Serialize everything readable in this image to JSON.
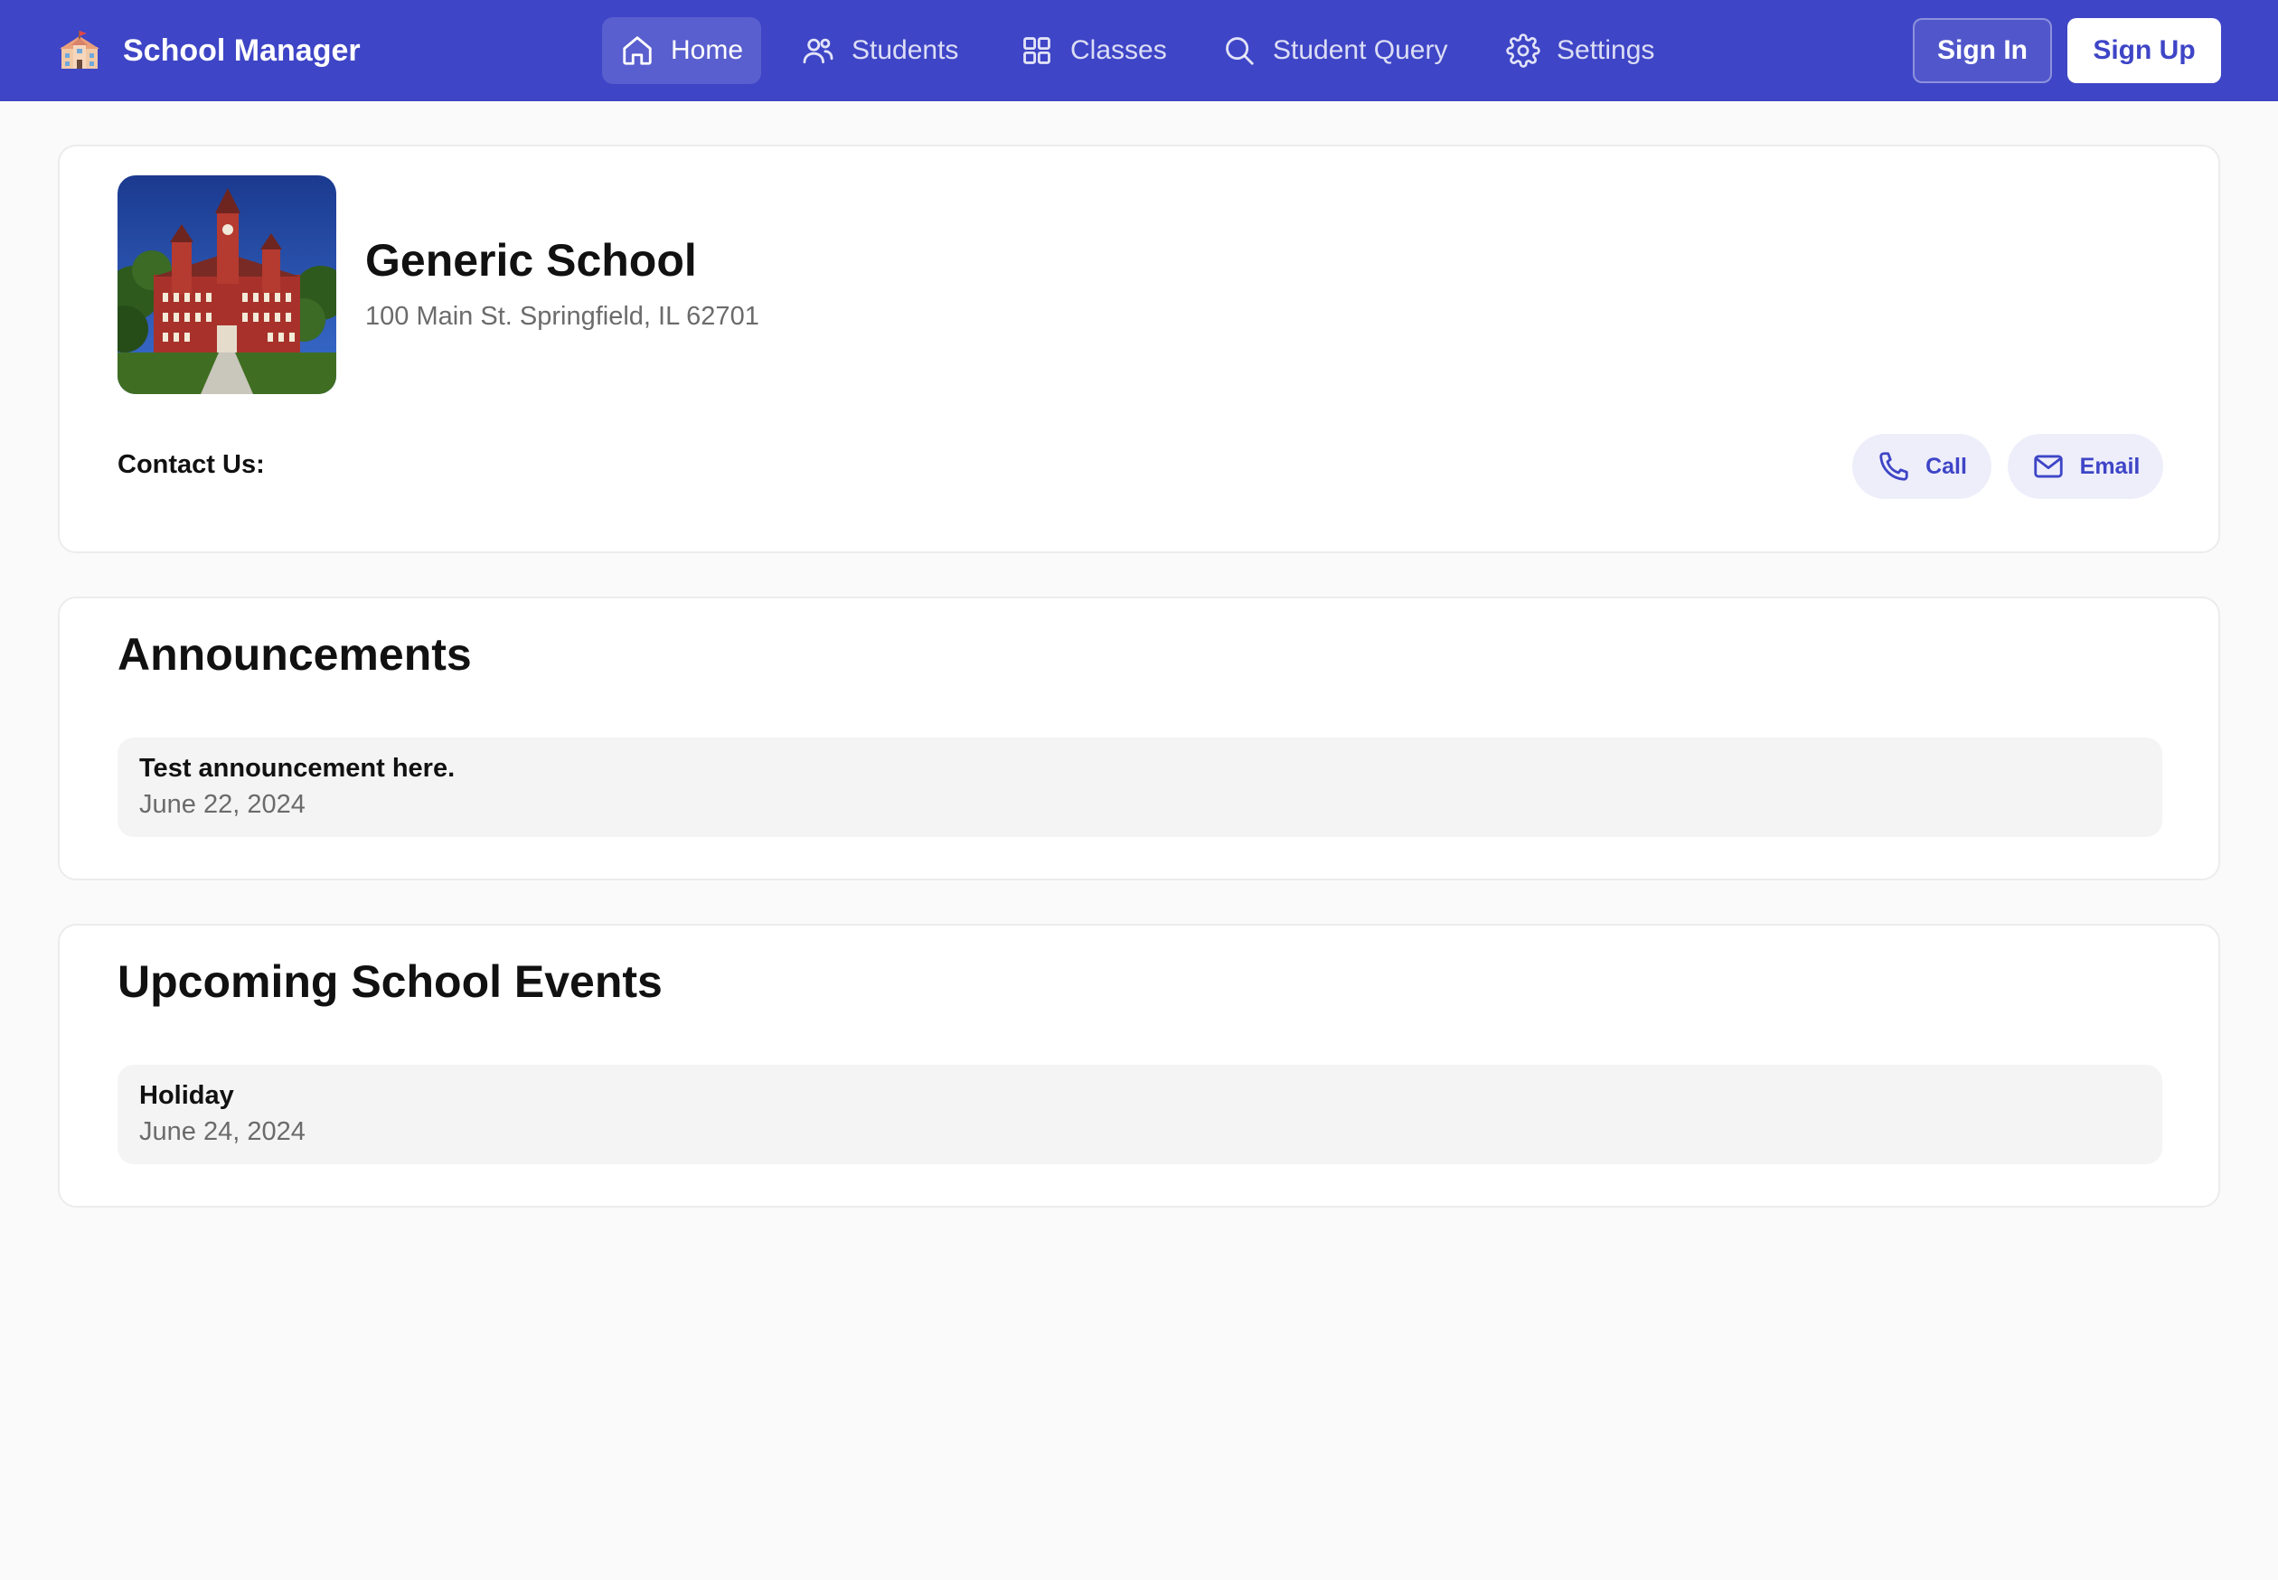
{
  "app": {
    "title": "School Manager",
    "brand_icon": "school-building-icon"
  },
  "nav": {
    "items": [
      {
        "label": "Home",
        "icon": "home-icon",
        "active": true
      },
      {
        "label": "Students",
        "icon": "users-icon",
        "active": false
      },
      {
        "label": "Classes",
        "icon": "grid-icon",
        "active": false
      },
      {
        "label": "Student Query",
        "icon": "search-icon",
        "active": false
      },
      {
        "label": "Settings",
        "icon": "gear-icon",
        "active": false
      }
    ],
    "sign_in_label": "Sign In",
    "sign_up_label": "Sign Up"
  },
  "school": {
    "name": "Generic School",
    "address": "100 Main St. Springfield, IL 62701",
    "contact_label": "Contact Us:",
    "call_label": "Call",
    "email_label": "Email"
  },
  "announcements": {
    "heading": "Announcements",
    "items": [
      {
        "title": "Test announcement here.",
        "date": "June 22, 2024"
      }
    ]
  },
  "events": {
    "heading": "Upcoming School Events",
    "items": [
      {
        "title": "Holiday",
        "date": "June 24, 2024"
      }
    ]
  },
  "colors": {
    "primary": "#3e45c6",
    "page_background": "#fafafa",
    "card_background": "#ffffff",
    "item_background": "#f4f4f4",
    "muted_text": "#6b6b6b",
    "contact_button_background": "#eeeefb"
  }
}
